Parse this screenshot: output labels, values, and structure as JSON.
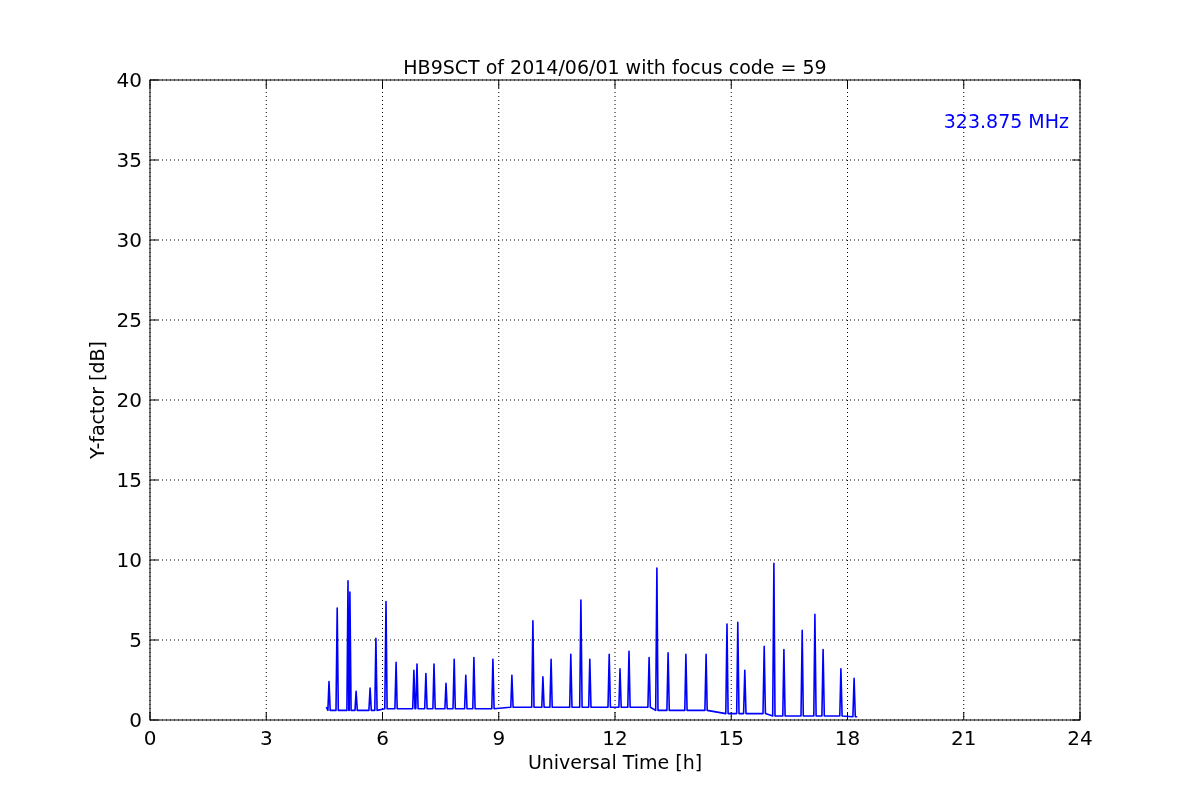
{
  "figure": {
    "chart_data": {
      "type": "line",
      "title": "HB9SCT of 2014/06/01 with focus code = 59",
      "xlabel": "Universal Time [h]",
      "ylabel": "Y-factor [dB]",
      "xlim": [
        0,
        24
      ],
      "ylim": [
        0,
        40
      ],
      "xticks": [
        0,
        3,
        6,
        9,
        12,
        15,
        18,
        21,
        24
      ],
      "yticks": [
        0,
        5,
        10,
        15,
        20,
        25,
        30,
        35,
        40
      ],
      "x": [
        4.55,
        4.59,
        4.62,
        4.65,
        4.8,
        4.83,
        4.86,
        5.08,
        5.11,
        5.13,
        5.14,
        5.16,
        5.19,
        5.29,
        5.32,
        5.35,
        5.65,
        5.68,
        5.71,
        5.8,
        5.83,
        5.86,
        6.06,
        6.09,
        6.12,
        6.32,
        6.35,
        6.38,
        6.78,
        6.81,
        6.84,
        6.86,
        6.89,
        6.92,
        7.09,
        7.12,
        7.15,
        7.3,
        7.33,
        7.36,
        7.61,
        7.64,
        7.67,
        7.82,
        7.85,
        7.88,
        8.12,
        8.15,
        8.18,
        8.33,
        8.36,
        8.39,
        8.82,
        8.85,
        8.88,
        9.31,
        9.34,
        9.37,
        9.85,
        9.88,
        9.91,
        10.11,
        10.14,
        10.17,
        10.32,
        10.35,
        10.38,
        10.83,
        10.86,
        10.89,
        11.09,
        11.12,
        11.15,
        11.32,
        11.35,
        11.38,
        11.82,
        11.85,
        11.88,
        12.1,
        12.13,
        12.16,
        12.33,
        12.36,
        12.39,
        12.85,
        12.88,
        12.91,
        13.05,
        13.08,
        13.11,
        13.34,
        13.37,
        13.4,
        13.8,
        13.83,
        13.86,
        14.32,
        14.35,
        14.38,
        14.86,
        14.89,
        14.92,
        15.14,
        15.17,
        15.2,
        15.32,
        15.35,
        15.38,
        15.82,
        15.85,
        15.88,
        16.07,
        16.1,
        16.13,
        16.33,
        16.36,
        16.39,
        16.8,
        16.83,
        16.86,
        17.13,
        17.16,
        17.19,
        17.34,
        17.37,
        17.4,
        17.8,
        17.83,
        17.86,
        18.14,
        18.17,
        18.2,
        18.25
      ],
      "series": [
        {
          "name": "323.875 MHz",
          "color": "#0000ff",
          "values": [
            0.8,
            0.6,
            2.4,
            0.6,
            0.6,
            7.0,
            0.6,
            0.6,
            8.7,
            0.6,
            0.6,
            8.0,
            0.6,
            0.6,
            1.8,
            0.6,
            0.6,
            2.0,
            0.6,
            0.6,
            5.1,
            0.6,
            0.7,
            7.4,
            0.7,
            0.7,
            3.6,
            0.7,
            0.7,
            3.1,
            0.7,
            0.7,
            3.5,
            0.7,
            0.7,
            2.9,
            0.7,
            0.7,
            3.5,
            0.7,
            0.7,
            2.3,
            0.7,
            0.7,
            3.8,
            0.7,
            0.7,
            2.8,
            0.7,
            0.7,
            3.9,
            0.7,
            0.7,
            3.8,
            0.7,
            0.8,
            2.8,
            0.8,
            0.8,
            6.2,
            0.8,
            0.8,
            2.7,
            0.8,
            0.8,
            3.8,
            0.8,
            0.8,
            4.1,
            0.8,
            0.8,
            7.5,
            0.8,
            0.8,
            3.8,
            0.8,
            0.8,
            4.1,
            0.8,
            0.8,
            3.2,
            0.8,
            0.8,
            4.3,
            0.8,
            0.8,
            3.9,
            0.8,
            0.6,
            9.5,
            0.6,
            0.6,
            4.2,
            0.6,
            0.6,
            4.1,
            0.6,
            0.6,
            4.1,
            0.6,
            0.4,
            6.0,
            0.4,
            0.4,
            6.1,
            0.4,
            0.4,
            3.1,
            0.4,
            0.4,
            4.6,
            0.4,
            0.25,
            9.8,
            0.25,
            0.25,
            4.4,
            0.25,
            0.25,
            5.6,
            0.25,
            0.25,
            6.6,
            0.25,
            0.25,
            4.4,
            0.25,
            0.25,
            3.2,
            0.25,
            0.2,
            2.6,
            0.2,
            0.2
          ]
        }
      ],
      "grid": true
    }
  }
}
